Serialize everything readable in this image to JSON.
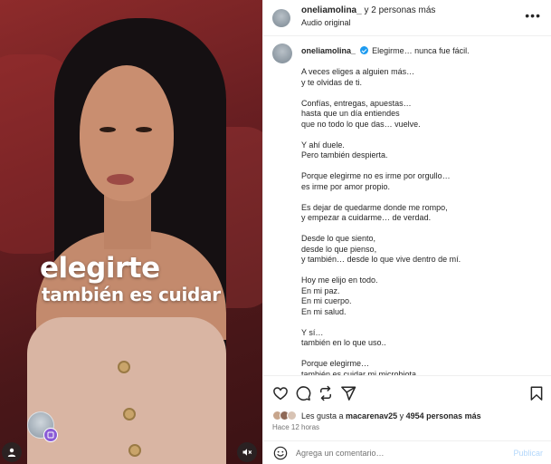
{
  "media": {
    "overlay_line1": "elegirte",
    "overlay_line2": "también es cuidar"
  },
  "header": {
    "username": "oneliamolina_",
    "coauthors": "y 2 personas más",
    "audio": "Audio original",
    "more_label": "•••"
  },
  "caption": {
    "username": "oneliamolina_",
    "headline": "Elegirme… nunca fue fácil.",
    "stanzas": [
      [
        "A veces eliges a alguien más…",
        "y te olvidas de ti."
      ],
      [
        "Confías, entregas, apuestas…",
        "hasta que un día entiendes",
        "que no todo lo que das… vuelve."
      ],
      [
        "Y ahí duele.",
        "Pero también despierta."
      ],
      [
        "Porque elegirme no es irme por orgullo…",
        "es irme por amor propio."
      ],
      [
        "Es dejar de quedarme donde me rompo,",
        "y empezar a cuidarme… de verdad."
      ],
      [
        "Desde lo que siento,",
        "desde lo que pienso,",
        "y también… desde lo que vive dentro de mí."
      ],
      [
        "Hoy me elijo en todo.",
        "En mi paz.",
        "En mi cuerpo.",
        "En mi salud."
      ],
      [
        "Y sí…",
        "también en lo que uso.."
      ],
      [
        "Porque elegirme…",
        "también es cuidar mi microbiota."
      ]
    ]
  },
  "likes": {
    "prefix": "Les gusta a ",
    "user": "macarenav25",
    "middle": " y ",
    "count": "4954 personas más"
  },
  "time": "Hace 12 horas",
  "comment": {
    "placeholder": "Agrega un comentario…",
    "publish": "Publicar"
  },
  "icons": {
    "header_avatar": "avatar",
    "caption_avatar": "avatar",
    "verified": "verified-badge-icon",
    "like": "heart-icon",
    "comment": "comment-icon",
    "share": "repost-icon",
    "send": "send-icon",
    "save": "bookmark-icon",
    "emoji": "emoji-icon",
    "mute": "speaker-muted-icon",
    "person": "person-icon"
  },
  "colors": {
    "verified": "#1d9bf0",
    "publish_disabled": "#b3d7fb",
    "muted_text": "#737373",
    "media_bg": "#6a1f22"
  }
}
